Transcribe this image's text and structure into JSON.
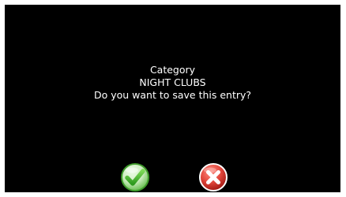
{
  "dialog": {
    "line1": "Category",
    "line2": "NIGHT CLUBS",
    "line3": "Do you want to save this entry?"
  },
  "buttons": {
    "confirm_icon": "green-checkmark-icon",
    "cancel_icon": "red-x-icon"
  },
  "colors": {
    "background": "#000000",
    "text": "#ffffff",
    "confirm": "#5cc23a",
    "cancel": "#d8342c"
  }
}
